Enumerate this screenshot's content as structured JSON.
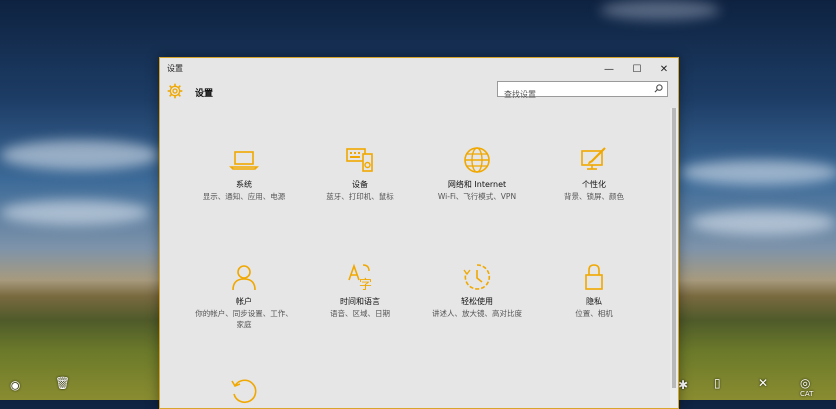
{
  "window": {
    "title": "设置",
    "minimize": "—",
    "maximize": "☐",
    "close": "✕"
  },
  "header": {
    "title": "设置",
    "search_placeholder": "查找设置"
  },
  "tiles": [
    {
      "name": "系统",
      "desc": "显示、通知、应用、电源",
      "icon": "laptop-icon"
    },
    {
      "name": "设备",
      "desc": "蓝牙、打印机、鼠标",
      "icon": "devices-icon"
    },
    {
      "name": "网络和 Internet",
      "desc": "Wi-Fi、飞行模式、VPN",
      "icon": "globe-icon"
    },
    {
      "name": "个性化",
      "desc": "背景、锁屏、颜色",
      "icon": "paint-icon"
    },
    {
      "name": "帐户",
      "desc": "你的帐户、同步设置、工作、家庭",
      "icon": "person-icon"
    },
    {
      "name": "时间和语言",
      "desc": "语音、区域、日期",
      "icon": "time-language-icon"
    },
    {
      "name": "轻松使用",
      "desc": "讲述人、放大镜、高对比度",
      "icon": "ease-of-access-icon"
    },
    {
      "name": "隐私",
      "desc": "位置、相机",
      "icon": "lock-icon"
    }
  ],
  "desktop": {
    "right_icon_label": "CAT"
  },
  "colors": {
    "accent": "#f0a800",
    "window_bg": "#e6e6e6",
    "border": "#d6a52a"
  }
}
